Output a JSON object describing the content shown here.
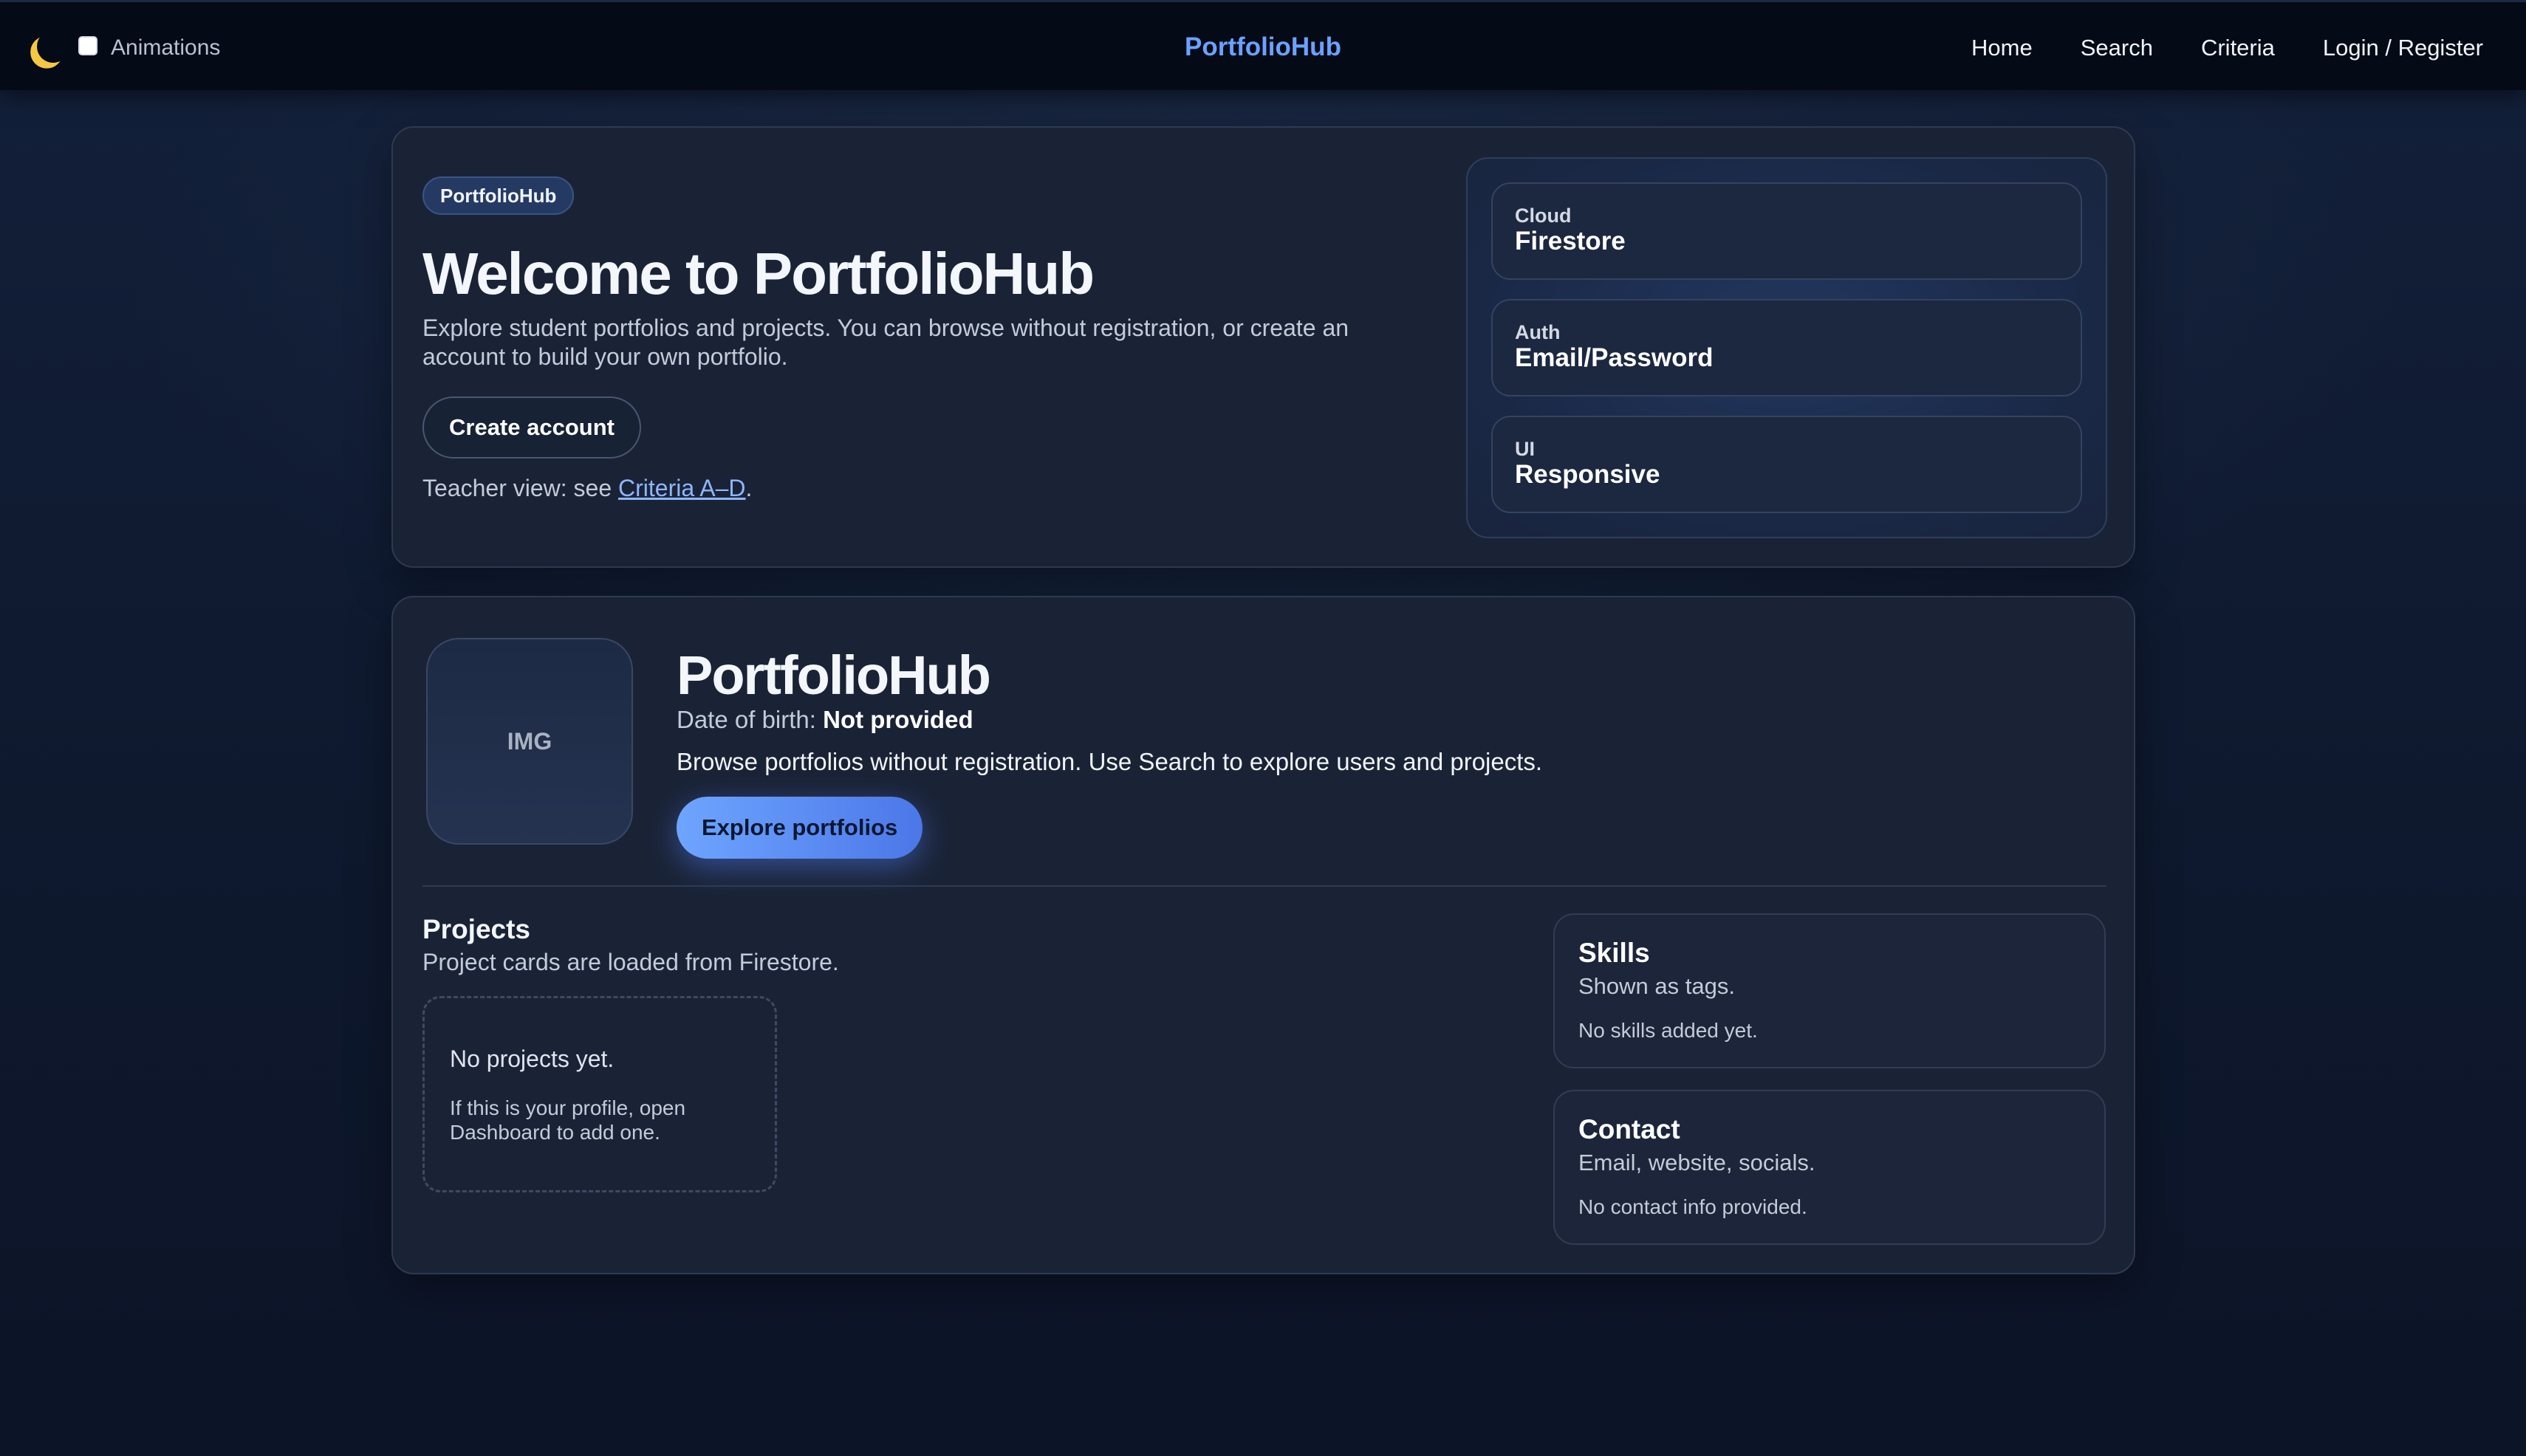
{
  "topbar": {
    "theme_icon": "crescent-moon-icon",
    "animations_label": "Animations",
    "animations_checked": false,
    "brand": "PortfolioHub",
    "nav": [
      "Home",
      "Search",
      "Criteria",
      "Login / Register"
    ]
  },
  "hero": {
    "pill": "PortfolioHub",
    "title": "Welcome to PortfolioHub",
    "description": "Explore student portfolios and projects. You can browse without registration, or create an account to build your own portfolio.",
    "create_button": "Create account",
    "teacher_prefix": "Teacher view: see ",
    "teacher_link": "Criteria A–D",
    "teacher_suffix": ".",
    "features": [
      {
        "key": "Cloud",
        "value": "Firestore"
      },
      {
        "key": "Auth",
        "value": "Email/Password"
      },
      {
        "key": "UI",
        "value": "Responsive"
      }
    ]
  },
  "profile": {
    "avatar_text": "IMG",
    "title": "PortfolioHub",
    "dob_label": "Date of birth: ",
    "dob_value": "Not provided",
    "description": "Browse portfolios without registration. Use Search to explore users and projects.",
    "explore_button": "Explore portfolios",
    "projects": {
      "title": "Projects",
      "subtitle": "Project cards are loaded from Firestore.",
      "empty_title": "No projects yet.",
      "empty_hint": "If this is your profile, open Dashboard to add one."
    },
    "skills": {
      "title": "Skills",
      "subtitle": "Shown as tags.",
      "note": "No skills added yet."
    },
    "contact": {
      "title": "Contact",
      "subtitle": "Email, website, socials.",
      "note": "No contact info provided."
    }
  },
  "colors": {
    "accent": "#6aa2ff",
    "link": "#8fb6ff",
    "primary_button": "#5b8cf5",
    "moon": "#f5c842"
  }
}
